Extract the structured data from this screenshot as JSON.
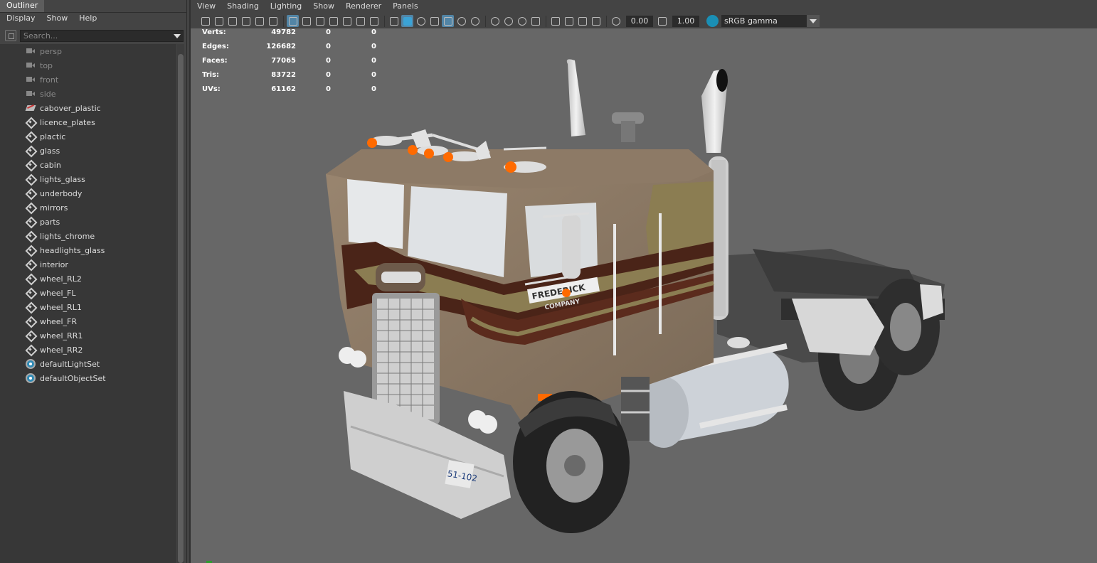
{
  "outliner": {
    "tab_label": "Outliner",
    "menu": [
      "Display",
      "Show",
      "Help"
    ],
    "search_placeholder": "Search...",
    "items": [
      {
        "label": "persp",
        "icon": "camera-icon",
        "dim": true
      },
      {
        "label": "top",
        "icon": "camera-icon",
        "dim": true
      },
      {
        "label": "front",
        "icon": "camera-icon",
        "dim": true
      },
      {
        "label": "side",
        "icon": "camera-icon",
        "dim": true
      },
      {
        "label": "cabover_plastic",
        "icon": "transform-icon",
        "dim": false
      },
      {
        "label": "licence_plates",
        "icon": "mesh-icon",
        "dim": false
      },
      {
        "label": "plactic",
        "icon": "mesh-icon",
        "dim": false
      },
      {
        "label": "glass",
        "icon": "mesh-icon",
        "dim": false
      },
      {
        "label": "cabin",
        "icon": "mesh-icon",
        "dim": false
      },
      {
        "label": "lights_glass",
        "icon": "mesh-icon",
        "dim": false
      },
      {
        "label": "underbody",
        "icon": "mesh-icon",
        "dim": false
      },
      {
        "label": "mirrors",
        "icon": "mesh-icon",
        "dim": false
      },
      {
        "label": "parts",
        "icon": "mesh-icon",
        "dim": false
      },
      {
        "label": "lights_chrome",
        "icon": "mesh-icon",
        "dim": false
      },
      {
        "label": "headlights_glass",
        "icon": "mesh-icon",
        "dim": false
      },
      {
        "label": "interior",
        "icon": "mesh-icon",
        "dim": false
      },
      {
        "label": "wheel_RL2",
        "icon": "mesh-icon",
        "dim": false
      },
      {
        "label": "wheel_FL",
        "icon": "mesh-icon",
        "dim": false
      },
      {
        "label": "wheel_RL1",
        "icon": "mesh-icon",
        "dim": false
      },
      {
        "label": "wheel_FR",
        "icon": "mesh-icon",
        "dim": false
      },
      {
        "label": "wheel_RR1",
        "icon": "mesh-icon",
        "dim": false
      },
      {
        "label": "wheel_RR2",
        "icon": "mesh-icon",
        "dim": false
      },
      {
        "label": "defaultLightSet",
        "icon": "set-icon",
        "dim": false
      },
      {
        "label": "defaultObjectSet",
        "icon": "set-icon",
        "dim": false
      }
    ]
  },
  "viewport": {
    "menu": [
      "View",
      "Shading",
      "Lighting",
      "Show",
      "Renderer",
      "Panels"
    ],
    "exposure": "0.00",
    "gamma": "1.00",
    "color_space": "sRGB gamma",
    "hud": [
      {
        "label": "Verts:",
        "v1": "49782",
        "v2": "0",
        "v3": "0"
      },
      {
        "label": "Edges:",
        "v1": "126682",
        "v2": "0",
        "v3": "0"
      },
      {
        "label": "Faces:",
        "v1": "77065",
        "v2": "0",
        "v3": "0"
      },
      {
        "label": "Tris:",
        "v1": "83722",
        "v2": "0",
        "v3": "0"
      },
      {
        "label": "UVs:",
        "v1": "61162",
        "v2": "0",
        "v3": "0"
      }
    ],
    "truck": {
      "door_logo_line1": "FREDERICK",
      "door_logo_line2": "COMPANY",
      "plate": "51-102",
      "body_color": "#8a7763",
      "stripe_dark": "#4a2418",
      "stripe_tan": "#8b7d52",
      "marker_orange": "#ff6a00"
    }
  }
}
